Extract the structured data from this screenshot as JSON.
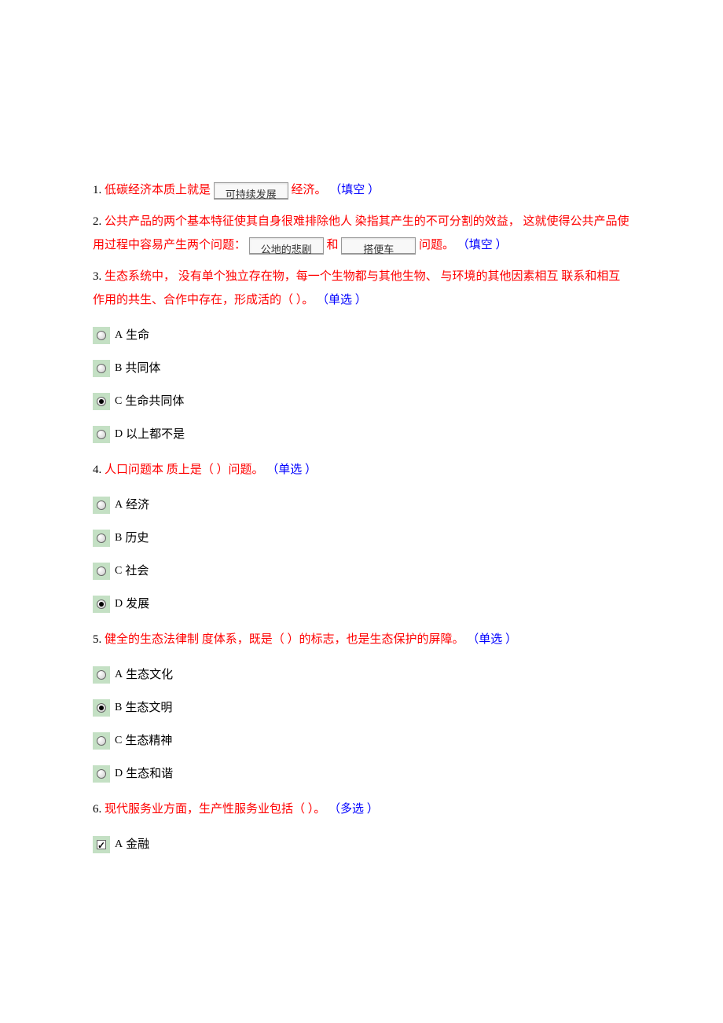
{
  "questions": [
    {
      "number": "1. ",
      "text_before_blank": "低碳经济本质上就是",
      "blank_value": "可持续发展",
      "text_after_blank": "经济。 ",
      "type": "（填空 ）"
    },
    {
      "number": "2. ",
      "text_part1": "公共产品的两个基本特征使其自身很难排除他人 染指其产生的不可分割的效益， 这就使得公共产品使用过程中容易产生两个问题：",
      "blank1_value": "公地的悲剧",
      "text_mid": "和",
      "blank2_value": "搭便车",
      "text_after": "问题。 ",
      "type": "（填空 ）"
    },
    {
      "number": "3. ",
      "text": "生态系统中， 没有单个独立存在物，每一个生物都与其他生物、 与环境的其他因素相互 联系和相互作用的共生、合作中存在，形成活的（ ）。 ",
      "type": "（单选 ）",
      "options": [
        {
          "label": "A",
          "text": "生命",
          "selected": false
        },
        {
          "label": "B",
          "text": "共同体",
          "selected": false
        },
        {
          "label": "C",
          "text": "生命共同体",
          "selected": true
        },
        {
          "label": "D",
          "text": "以上都不是",
          "selected": false
        }
      ]
    },
    {
      "number": "4. ",
      "text": "人口问题本 质上是（ ）问题。 ",
      "type": "（单选 ）",
      "options": [
        {
          "label": "A",
          "text": "经济",
          "selected": false
        },
        {
          "label": "B",
          "text": "历史",
          "selected": false
        },
        {
          "label": "C",
          "text": "社会",
          "selected": false
        },
        {
          "label": "D",
          "text": "发展",
          "selected": true
        }
      ]
    },
    {
      "number": "5. ",
      "text": "健全的生态法律制 度体系，既是（ ）的标志，也是生态保护的屏障。 ",
      "type": "（单选 ）",
      "options": [
        {
          "label": "A",
          "text": "生态文化",
          "selected": false
        },
        {
          "label": "B",
          "text": "生态文明",
          "selected": true
        },
        {
          "label": "C",
          "text": "生态精神",
          "selected": false
        },
        {
          "label": "D",
          "text": "生态和谐",
          "selected": false
        }
      ]
    },
    {
      "number": "6. ",
      "text": "现代服务业方面，生产性服务业包括（ ）。 ",
      "type": "（多选 ）",
      "options": [
        {
          "label": "A",
          "text": "金融",
          "checked": true
        }
      ]
    }
  ]
}
